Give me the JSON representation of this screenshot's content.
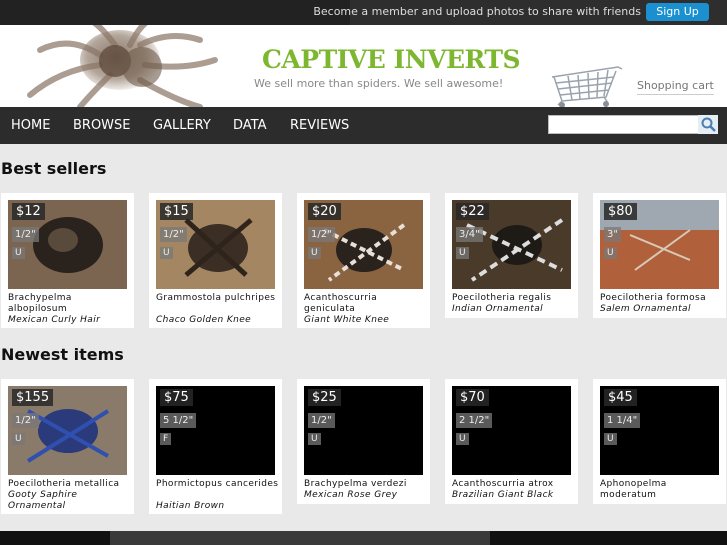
{
  "topbar": {
    "promo_text": "Become a member and upload photos to share with friends",
    "signup_label": "Sign Up"
  },
  "header": {
    "logo_text": "CAPTIVE INVERTS",
    "tagline": "We sell more than spiders. We sell awesome!",
    "cart_label": "Shopping cart"
  },
  "nav": {
    "items": [
      "HOME",
      "BROWSE",
      "GALLERY",
      "DATA",
      "REVIEWS"
    ],
    "search_placeholder": ""
  },
  "best_sellers": {
    "title": "Best sellers",
    "items": [
      {
        "price": "$12",
        "size": "1/2\"",
        "sex": "U",
        "name": "Brachypelma albopilosum",
        "common": "Mexican Curly Hair"
      },
      {
        "price": "$15",
        "size": "1/2\"",
        "sex": "U",
        "name": "Grammostola pulchripes",
        "common": "Chaco Golden Knee"
      },
      {
        "price": "$20",
        "size": "1/2\"",
        "sex": "U",
        "name": "Acanthoscurria geniculata",
        "common": "Giant White Knee"
      },
      {
        "price": "$22",
        "size": "3/4\"",
        "sex": "U",
        "name": "Poecilotheria regalis",
        "common": "Indian Ornamental"
      },
      {
        "price": "$80",
        "size": "3\"",
        "sex": "U",
        "name": "Poecilotheria formosa",
        "common": "Salem Ornamental"
      }
    ]
  },
  "newest": {
    "title": "Newest items",
    "items": [
      {
        "price": "$155",
        "size": "1/2\"",
        "sex": "U",
        "name": "Poecilotheria metallica",
        "common": "Gooty Saphire Ornamental"
      },
      {
        "price": "$75",
        "size": "5 1/2\"",
        "sex": "F",
        "name": "Phormictopus cancerides",
        "common": "Haitian Brown"
      },
      {
        "price": "$25",
        "size": "1/2\"",
        "sex": "U",
        "name": "Brachypelma verdezi",
        "common": "Mexican Rose Grey"
      },
      {
        "price": "$70",
        "size": "2 1/2\"",
        "sex": "U",
        "name": "Acanthoscurria atrox",
        "common": "Brazilian Giant Black"
      },
      {
        "price": "$45",
        "size": "1 1/4\"",
        "sex": "U",
        "name": "Aphonopelma moderatum",
        "common": ""
      }
    ]
  }
}
